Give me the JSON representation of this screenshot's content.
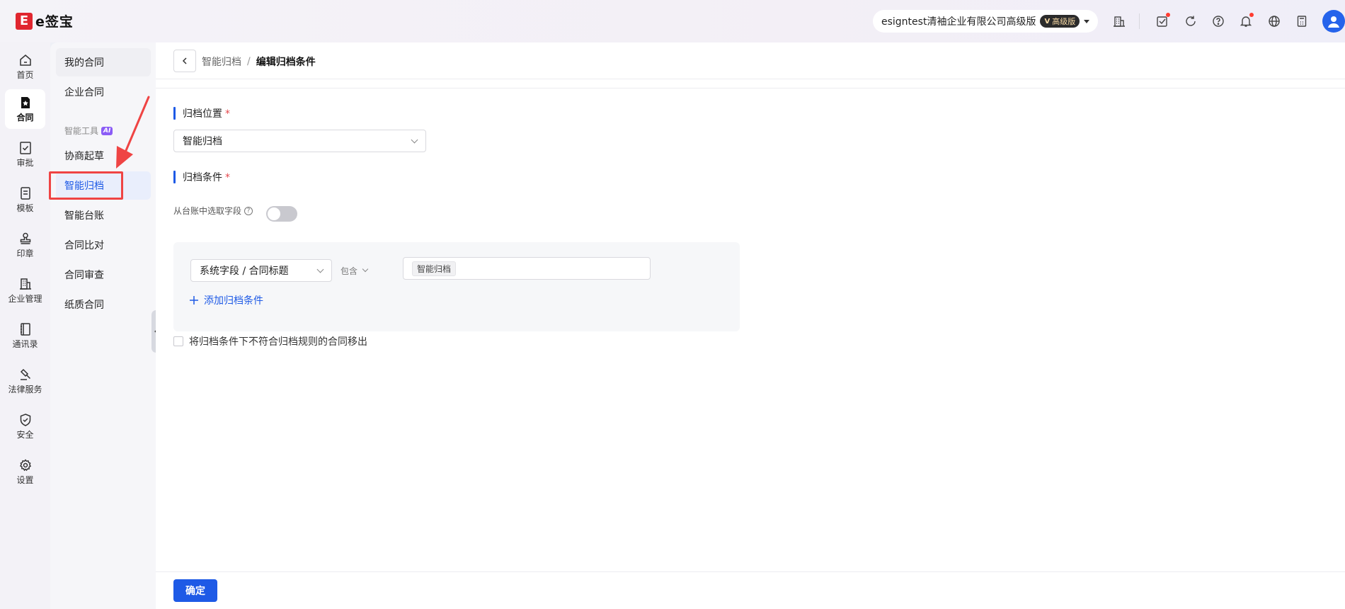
{
  "header": {
    "logo_mark": "E",
    "logo_text": "e签宝",
    "org_name": "esigntest清袖企业有限公司高级版",
    "plan_badge": "高级版"
  },
  "rail": [
    {
      "label": "首页",
      "icon": "home-icon"
    },
    {
      "label": "合同",
      "icon": "contract-icon",
      "active": true
    },
    {
      "label": "审批",
      "icon": "approval-icon"
    },
    {
      "label": "模板",
      "icon": "template-icon"
    },
    {
      "label": "印章",
      "icon": "seal-icon"
    },
    {
      "label": "企业管理",
      "icon": "building-icon"
    },
    {
      "label": "通讯录",
      "icon": "contacts-icon"
    },
    {
      "label": "法律服务",
      "icon": "gavel-icon"
    },
    {
      "label": "安全",
      "icon": "shield-icon"
    },
    {
      "label": "设置",
      "icon": "gear-icon"
    }
  ],
  "subnav": {
    "items_top": [
      "我的合同",
      "企业合同"
    ],
    "group_label": "智能工具",
    "group_badge": "AI",
    "items_tools": [
      "协商起草",
      "智能归档",
      "智能台账",
      "合同比对",
      "合同审查",
      "纸质合同"
    ],
    "active": "智能归档"
  },
  "breadcrumb": {
    "prev": "智能归档",
    "separator": "/",
    "current": "编辑归档条件"
  },
  "form": {
    "location_title": "归档位置",
    "required_mark": "*",
    "location_value": "智能归档",
    "condition_title": "归档条件",
    "toggle_label": "从台账中选取字段",
    "toggle_on": false,
    "field_select": "系统字段 / 合同标题",
    "operator": "包含",
    "value_tag": "智能归档",
    "add_condition": "添加归档条件",
    "move_out_label": "将归档条件下不符合归档规则的合同移出",
    "move_out_checked": false
  },
  "footer": {
    "confirm": "确定"
  },
  "colors": {
    "accent": "#1e5ae6",
    "highlight": "#ef4444"
  }
}
